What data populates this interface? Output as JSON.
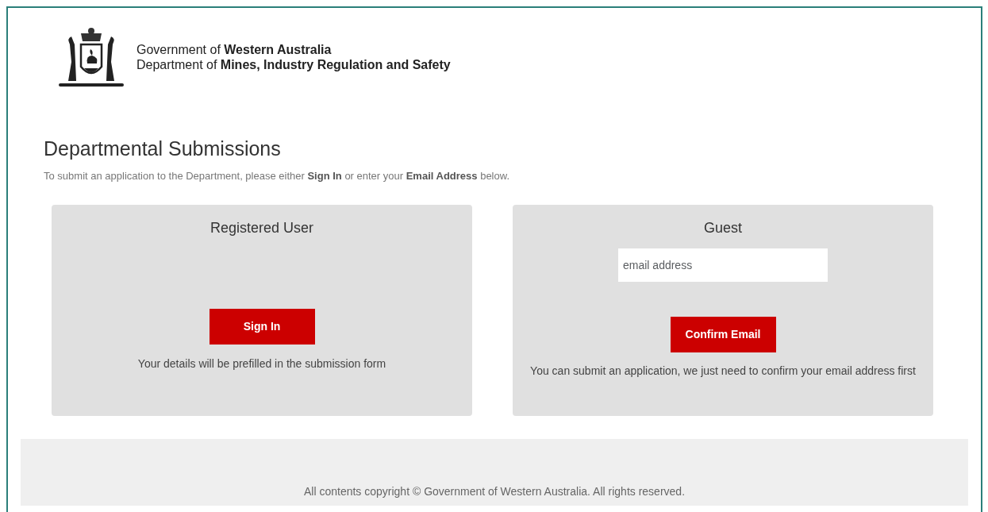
{
  "header": {
    "line_1": "Government of **Western Australia**",
    "line_2": "Department of **Mines, Industry Regulation and Safety**"
  },
  "title": "Departmental Submissions",
  "intro": "To submit an application to the Department, please either **Sign In** or enter your **Email Address** below.",
  "panels": [
    {
      "kind": "signin",
      "title": "Registered User",
      "button": "Sign In",
      "note": "Your details will be prefilled in the submission form"
    },
    {
      "kind": "guest",
      "title": "Guest",
      "placeholder": "email address",
      "button": "Confirm Email",
      "note": "You can submit an application, we just need to confirm your email address first"
    }
  ],
  "footer": "All contents copyright © Government of Western Australia. All rights reserved."
}
